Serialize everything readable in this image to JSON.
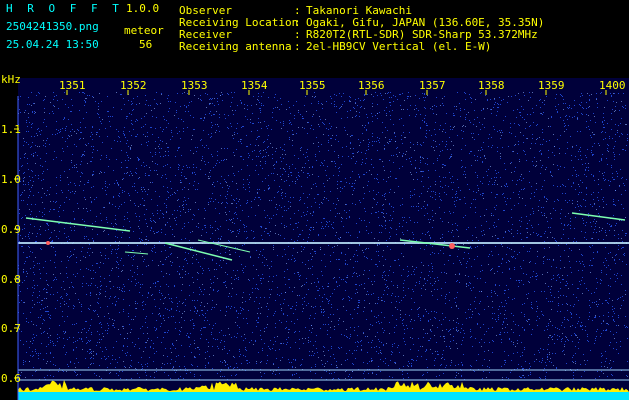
{
  "header": {
    "app_name": "H R O F F T",
    "version": "1.0.0",
    "filename": "2504241350.png",
    "datetime": "25.04.24 13:50",
    "count_label": "meteor",
    "count_value": "56",
    "fields": [
      {
        "label": "Observer",
        "sep": ":",
        "value": "Takanori Kawachi"
      },
      {
        "label": "Receiving Location",
        "sep": ":",
        "value": "Ogaki, Gifu, JAPAN (136.60E, 35.35N)"
      },
      {
        "label": "Receiver",
        "sep": ":",
        "value": "R820T2(RTL-SDR) SDR-Sharp 53.372MHz"
      },
      {
        "label": "Receiving antenna",
        "sep": ":",
        "value": "2el-HB9CV Vertical (el. E-W)"
      }
    ]
  },
  "spectrogram": {
    "y_unit": "kHz",
    "y_ticks": [
      "1.1",
      "1.0",
      "0.9",
      "0.8",
      "0.7",
      "0.6"
    ],
    "x_ticks": [
      "1351",
      "1352",
      "1353",
      "1354",
      "1355",
      "1356",
      "1357",
      "1358",
      "1359",
      "1400"
    ],
    "colors": {
      "background": "#00003a",
      "noise": "#2a5cff",
      "carrier": "#bfe9ff",
      "echo": "#7dffb0",
      "level": "#ffee00",
      "baseline": "#00e5ff"
    }
  }
}
